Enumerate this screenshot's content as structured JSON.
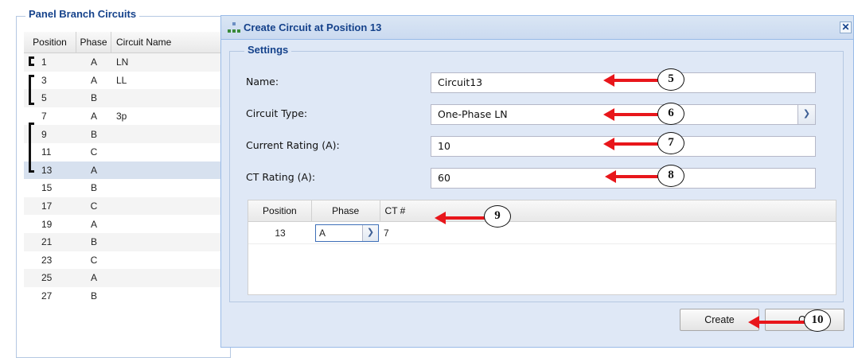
{
  "panel": {
    "title": "Panel Branch Circuits",
    "columns": {
      "position": "Position",
      "phase": "Phase",
      "name": "Circuit Name"
    },
    "rows": [
      {
        "position": "1",
        "phase": "A",
        "name": "LN"
      },
      {
        "position": "3",
        "phase": "A",
        "name": "LL"
      },
      {
        "position": "5",
        "phase": "B",
        "name": ""
      },
      {
        "position": "7",
        "phase": "A",
        "name": "3p"
      },
      {
        "position": "9",
        "phase": "B",
        "name": ""
      },
      {
        "position": "11",
        "phase": "C",
        "name": ""
      },
      {
        "position": "13",
        "phase": "A",
        "name": ""
      },
      {
        "position": "15",
        "phase": "B",
        "name": ""
      },
      {
        "position": "17",
        "phase": "C",
        "name": ""
      },
      {
        "position": "19",
        "phase": "A",
        "name": ""
      },
      {
        "position": "21",
        "phase": "B",
        "name": ""
      },
      {
        "position": "23",
        "phase": "C",
        "name": ""
      },
      {
        "position": "25",
        "phase": "A",
        "name": ""
      },
      {
        "position": "27",
        "phase": "B",
        "name": ""
      }
    ]
  },
  "dialog": {
    "title": "Create Circuit at Position 13",
    "close_glyph": "✕",
    "settings_legend": "Settings",
    "name_label": "Name:",
    "name_value": "Circuit13",
    "circuit_type_label": "Circuit Type:",
    "circuit_type_value": "One-Phase LN",
    "current_rating_label": "Current Rating (A):",
    "current_rating_value": "10",
    "ct_rating_label": "CT Rating (A):",
    "ct_rating_value": "60",
    "ct_grid": {
      "columns": {
        "position": "Position",
        "phase": "Phase",
        "ct": "CT #"
      },
      "row": {
        "position": "13",
        "phase": "A",
        "ct": "7"
      }
    },
    "create_label": "Create",
    "cancel_label": "Ca"
  },
  "callouts": [
    "5",
    "6",
    "7",
    "8",
    "9",
    "10"
  ],
  "icons": {
    "dropdown": "chevron-down-icon",
    "dialog": "circuit-tree-icon",
    "close": "close-icon"
  },
  "colors": {
    "annotation_arrow": "#e8161b",
    "title_text": "#15428b",
    "selected_row": "#d7e1ef"
  }
}
